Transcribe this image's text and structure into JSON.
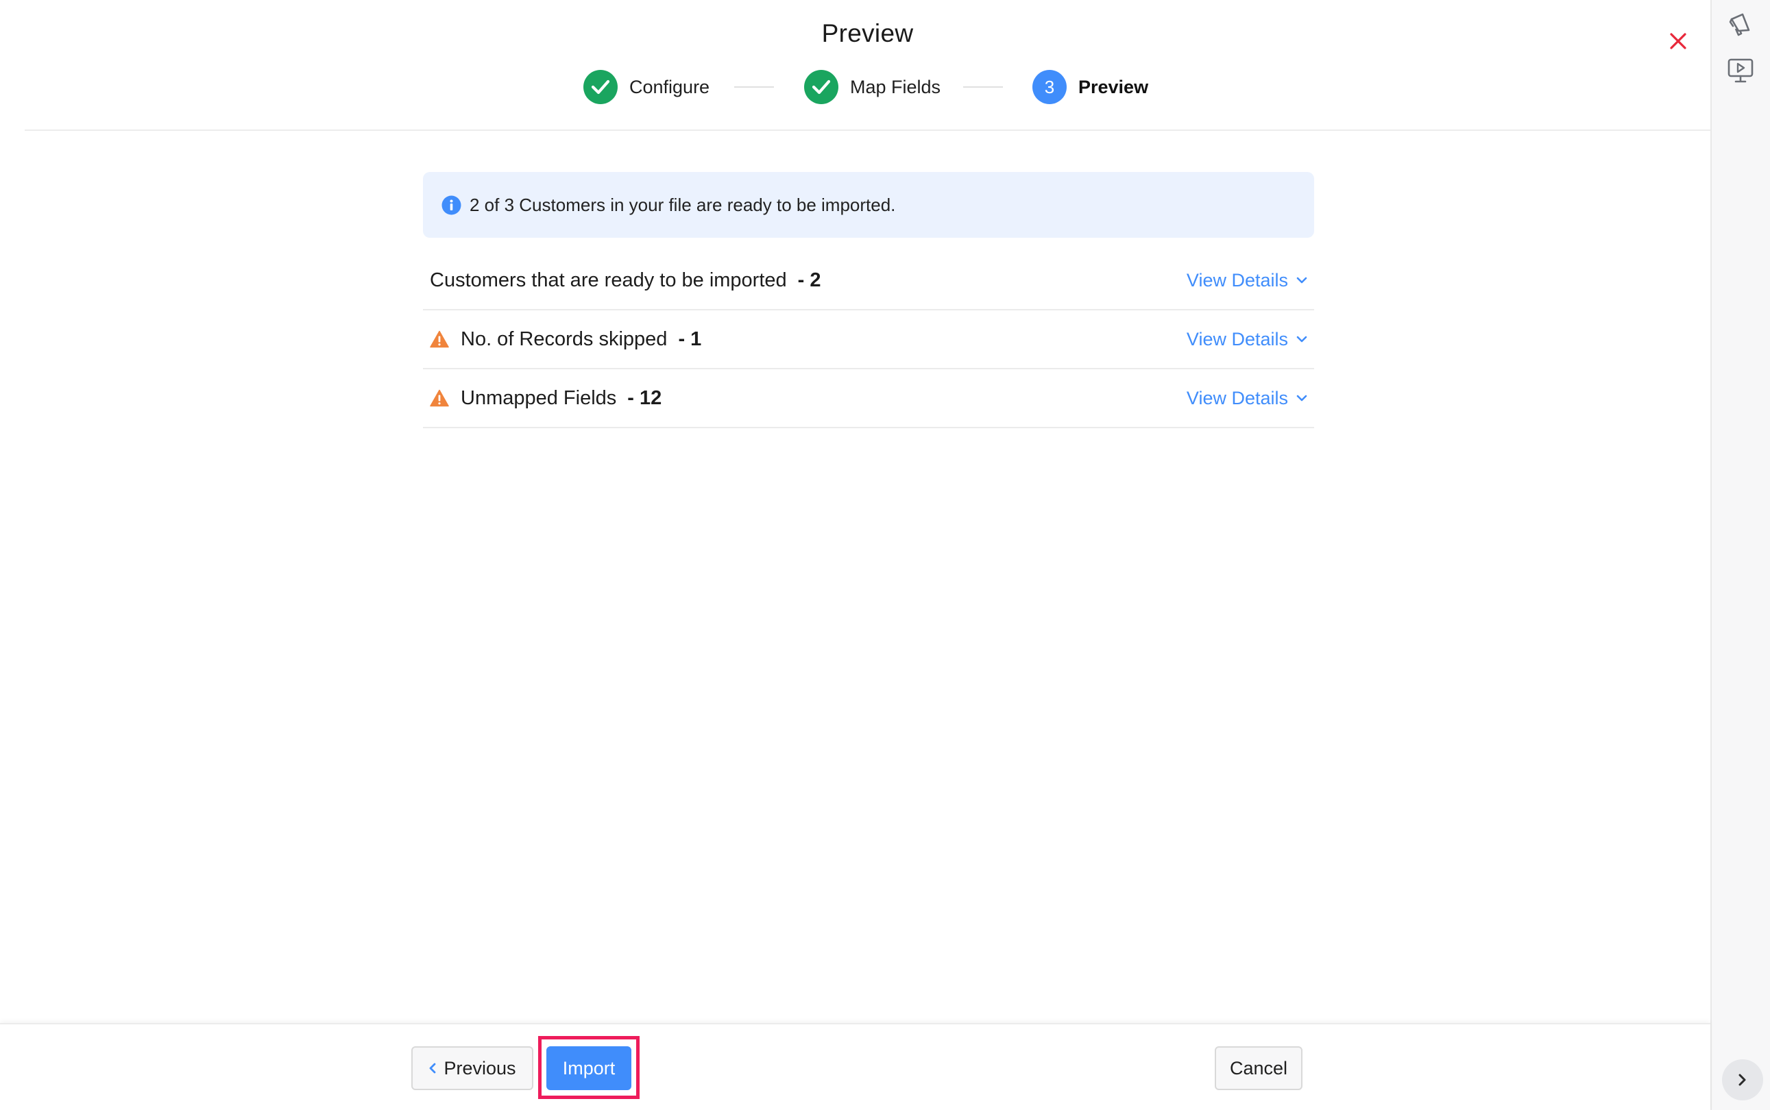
{
  "header": {
    "title": "Preview",
    "close_label": "Close"
  },
  "stepper": {
    "steps": [
      {
        "label": "Configure",
        "status": "done"
      },
      {
        "label": "Map Fields",
        "status": "done"
      },
      {
        "label": "Preview",
        "status": "active",
        "number": "3"
      }
    ]
  },
  "info_banner": {
    "text": "2 of 3 Customers in your file are ready to be imported."
  },
  "summary": {
    "rows": [
      {
        "label": "Customers that are ready to be imported",
        "count": "- 2",
        "warning": false,
        "action": "View Details"
      },
      {
        "label": "No. of Records skipped",
        "count": "- 1",
        "warning": true,
        "action": "View Details"
      },
      {
        "label": "Unmapped Fields",
        "count": "- 12",
        "warning": true,
        "action": "View Details"
      }
    ]
  },
  "footer": {
    "previous_label": "Previous",
    "import_label": "Import",
    "cancel_label": "Cancel"
  },
  "colors": {
    "accent": "#408dfb",
    "success": "#1aa55f",
    "warning": "#f0843c",
    "close": "#e8283a",
    "highlight": "#ee1c5b",
    "banner_bg": "#ebf2fe"
  },
  "icons": {
    "close": "close-icon",
    "check": "check-icon",
    "info": "info-icon",
    "warning": "warning-icon",
    "chevron": "chevron-down-icon",
    "announcement": "megaphone-icon",
    "tutorial": "video-tutorial-icon",
    "collapse": "chevron-right-icon"
  }
}
